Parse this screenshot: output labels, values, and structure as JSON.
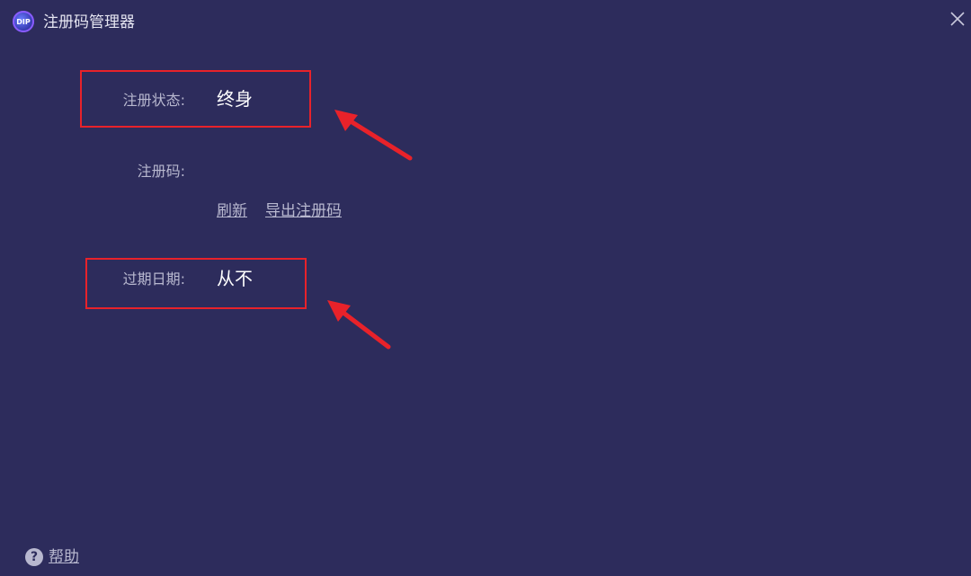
{
  "window": {
    "title": "注册码管理器",
    "close_icon": "close-icon",
    "app_icon": "app-logo-icon"
  },
  "fields": {
    "status_label": "注册状态:",
    "status_value": "终身",
    "code_label": "注册码:",
    "expiry_label": "过期日期:",
    "expiry_value": "从不"
  },
  "actions": {
    "refresh_label": "刷新",
    "export_label": "导出注册码"
  },
  "footer": {
    "help_label": "帮助",
    "help_icon_glyph": "?"
  },
  "colors": {
    "background": "#2d2c5c",
    "highlight": "#e8222a",
    "label": "#b8b8cf",
    "value": "#ffffff"
  }
}
